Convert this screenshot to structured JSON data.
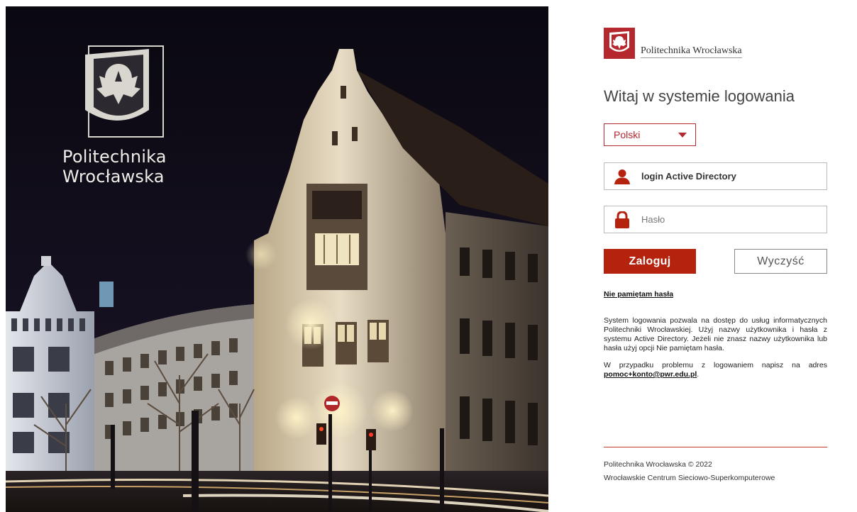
{
  "hero": {
    "name_line1": "Politechnika",
    "name_line2": "Wrocławska"
  },
  "brand": {
    "name": "Politechnika Wrocławska"
  },
  "login": {
    "title": "Witaj w systemie logowania",
    "language": "Polski",
    "username_placeholder": "login Active Directory",
    "password_placeholder": "Hasło",
    "login_button": "Zaloguj",
    "clear_button": "Wyczyść",
    "forgot_link": "Nie pamiętam hasła"
  },
  "info": {
    "paragraph1": "System logowania pozwala na dostęp do usług informatycznych Politechniki Wrocławskiej. Użyj nazwy użytkownika i hasła z systemu Active Directory. Jeżeli nie znasz nazwy użytkownika lub hasła użyj opcji Nie pamiętam hasła.",
    "paragraph2": "W przypadku problemu z logowaniem napisz na adres ",
    "email": "pomoc+konto@pwr.edu.pl",
    "email_suffix": "."
  },
  "footer": {
    "copyright": "Politechnika Wrocławska © 2022",
    "center": "Wrocławskie Centrum Sieciowo-Superkomputerowe"
  },
  "colors": {
    "brand_red": "#b5282e",
    "button_red": "#b5230f"
  },
  "icons": {
    "user": "user-icon",
    "lock": "lock-icon",
    "select_caret": "caret-down-icon",
    "crest": "eagle-crest-icon"
  }
}
